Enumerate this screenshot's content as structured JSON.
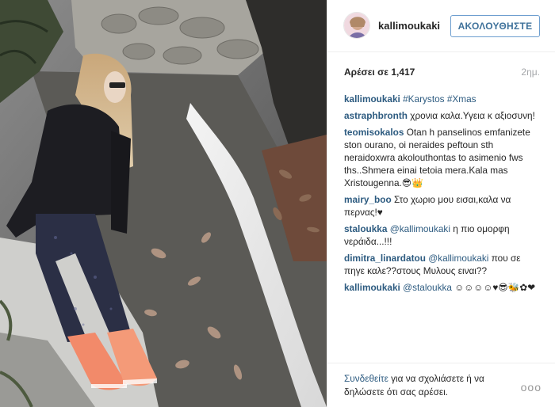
{
  "header": {
    "username": "kallimoukaki",
    "follow_label": "ΑΚΟΛΟΥΘΗΣΤΕ"
  },
  "stats": {
    "likes": "Αρέσει σε 1,417",
    "time": "2ημ."
  },
  "comments": [
    {
      "user": "kallimoukaki",
      "parts": [
        {
          "type": "tag",
          "text": "#Karystos"
        },
        {
          "type": "text",
          "text": " "
        },
        {
          "type": "tag",
          "text": "#Xmas"
        }
      ]
    },
    {
      "user": "astraphbronth",
      "parts": [
        {
          "type": "text",
          "text": "χρονια καλα.Υγεια κ αξιοσυνη!"
        }
      ]
    },
    {
      "user": "teomisokalos",
      "parts": [
        {
          "type": "text",
          "text": "Otan h panselinos emfanizete ston ourano, oi neraides peftoun sth neraidoxwra akolouthontas to asimenio fws ths..Shmera einai tetoia mera.Kala mas Xristougenna.😎👑"
        }
      ]
    },
    {
      "user": "mairy_boo",
      "parts": [
        {
          "type": "text",
          "text": "Στο χωριο μου εισαι,καλα να περνας!♥"
        }
      ]
    },
    {
      "user": "staloukka",
      "parts": [
        {
          "type": "mention",
          "text": "@kallimoukaki"
        },
        {
          "type": "text",
          "text": " η πιο ομορφη νεράιδα...!!!"
        }
      ]
    },
    {
      "user": "dimitra_linardatou",
      "parts": [
        {
          "type": "mention",
          "text": "@kallimoukaki"
        },
        {
          "type": "text",
          "text": " που σε πηγε καλε??στους Μυλους ειναι??"
        }
      ]
    },
    {
      "user": "kallimoukaki",
      "parts": [
        {
          "type": "mention",
          "text": "@staloukka"
        },
        {
          "type": "text",
          "text": " ☺☺☺☺♥😎🐝✿❤"
        }
      ]
    }
  ],
  "footer": {
    "login_link": "Συνδεθείτε",
    "login_text": " για να σχολιάσετε ή να δηλώσετε ότι σας αρέσει.",
    "more": "ooo"
  },
  "colors": {
    "link": "#2d5b80",
    "follow_border": "#6d9ecf",
    "follow_text": "#3f729b",
    "muted": "#a5a7aa"
  },
  "icons": {
    "avatar": "profile-avatar",
    "more": "ellipsis-icon"
  }
}
